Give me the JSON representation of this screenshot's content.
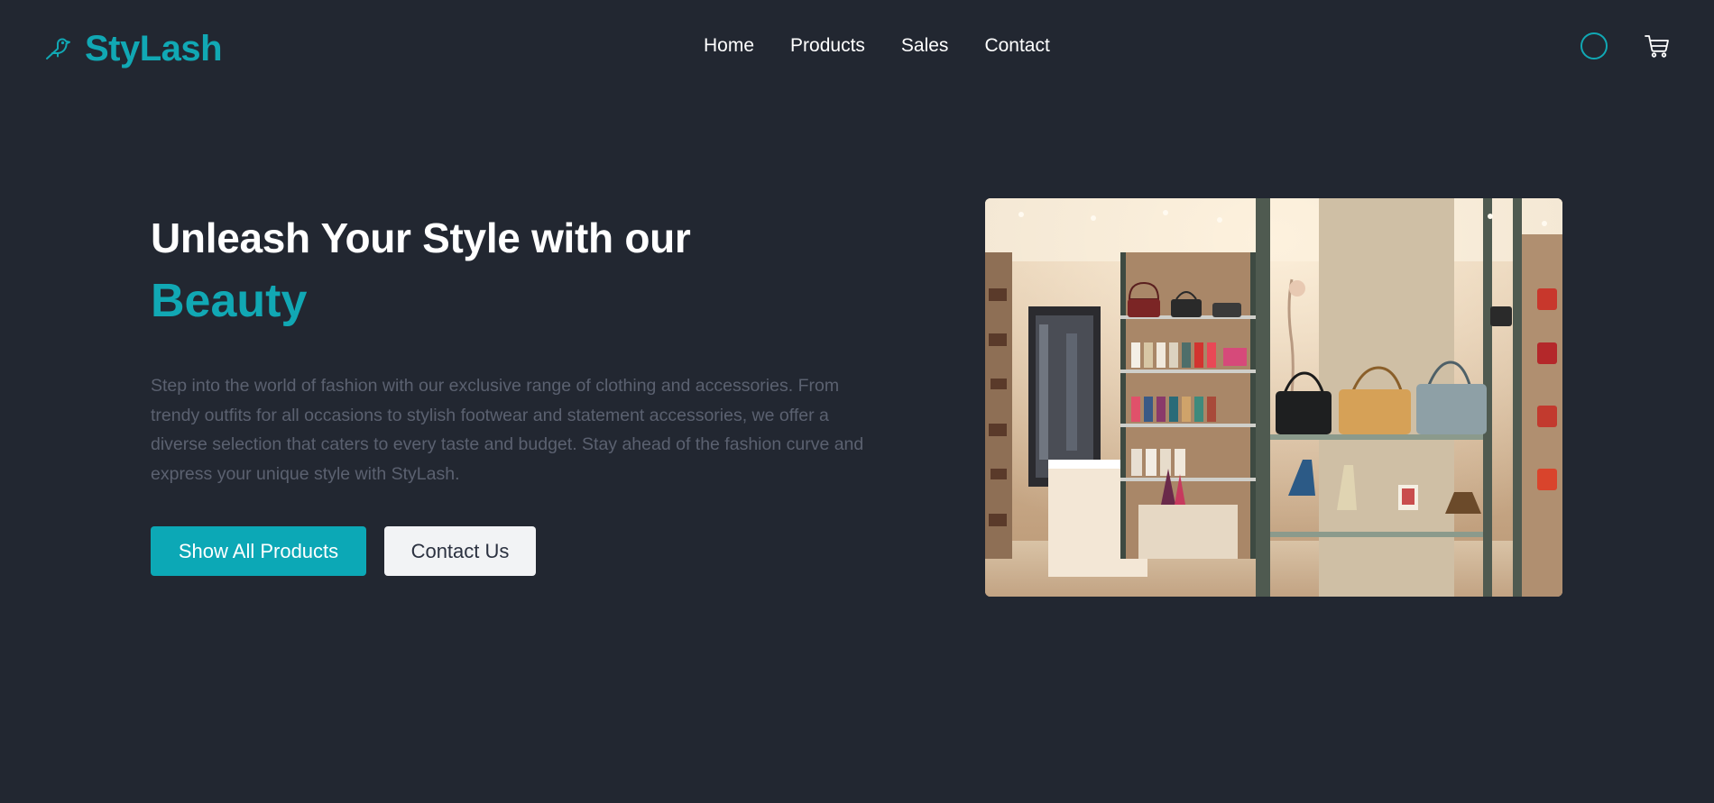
{
  "brand": {
    "name": "StyLash",
    "logo_icon": "bird-icon",
    "accent_color": "#11a8b4"
  },
  "nav": {
    "items": [
      {
        "label": "Home"
      },
      {
        "label": "Products"
      },
      {
        "label": "Sales"
      },
      {
        "label": "Contact"
      }
    ]
  },
  "header_actions": {
    "profile_icon": "user-circle-icon",
    "cart_icon": "shopping-cart-icon"
  },
  "hero": {
    "headline": "Unleash Your Style with our",
    "headline_accent": "Beauty",
    "description": "Step into the world of fashion with our exclusive range of clothing and accessories. From trendy outfits for all occasions to stylish footwear and statement accessories, we offer a diverse selection that caters to every taste and budget. Stay ahead of the fashion curve and express your unique style with StyLash.",
    "primary_button": "Show All Products",
    "secondary_button": "Contact Us"
  },
  "colors": {
    "background": "#222731",
    "accent": "#11a8b4",
    "primary_button": "#0ca8b6",
    "secondary_button": "#f2f3f5",
    "muted_text": "#5b6170"
  }
}
